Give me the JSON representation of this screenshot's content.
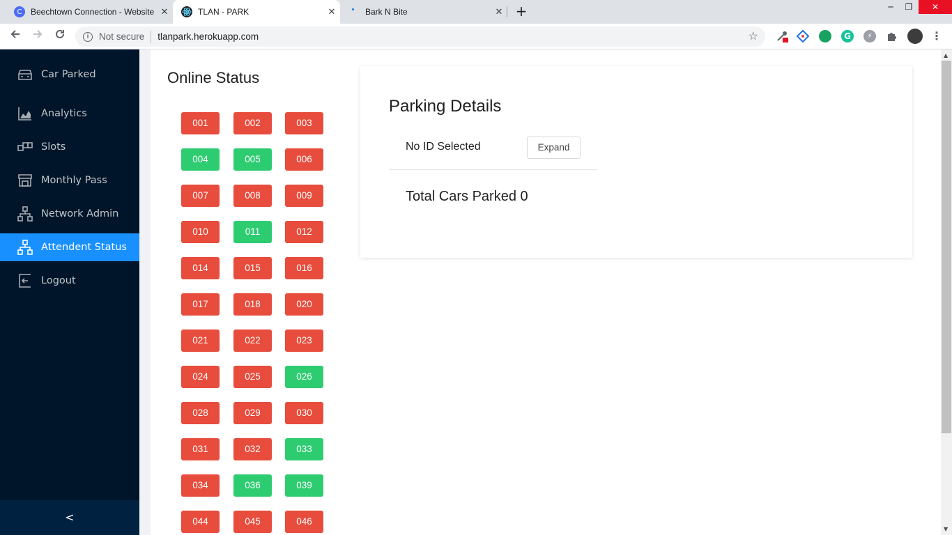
{
  "browser": {
    "tabs": [
      {
        "title": "Beechtown Connection - Website",
        "favicon": "beechtown-c-icon"
      },
      {
        "title": "TLAN - PARK",
        "favicon": "react-icon"
      },
      {
        "title": "Bark N Bite",
        "favicon": "loading-dot-icon"
      }
    ],
    "security_label": "Not secure",
    "url": "tlanpark.herokuapp.com"
  },
  "sidebar": {
    "items": [
      {
        "label": "Car Parked",
        "icon": "car-icon"
      },
      {
        "label": "Analytics",
        "icon": "area-chart-icon"
      },
      {
        "label": "Slots",
        "icon": "slots-icon"
      },
      {
        "label": "Monthly Pass",
        "icon": "shop-icon"
      },
      {
        "label": "Network Admin",
        "icon": "cluster-icon"
      },
      {
        "label": "Attendent Status",
        "icon": "cluster-icon"
      },
      {
        "label": "Logout",
        "icon": "logout-icon"
      }
    ],
    "active_index": 5,
    "collapse_glyph": "<"
  },
  "online_status": {
    "title": "Online Status",
    "slots": [
      {
        "id": "001",
        "online": false
      },
      {
        "id": "002",
        "online": false
      },
      {
        "id": "003",
        "online": false
      },
      {
        "id": "004",
        "online": true
      },
      {
        "id": "005",
        "online": true
      },
      {
        "id": "006",
        "online": false
      },
      {
        "id": "007",
        "online": false
      },
      {
        "id": "008",
        "online": false
      },
      {
        "id": "009",
        "online": false
      },
      {
        "id": "010",
        "online": false
      },
      {
        "id": "011",
        "online": true
      },
      {
        "id": "012",
        "online": false
      },
      {
        "id": "014",
        "online": false
      },
      {
        "id": "015",
        "online": false
      },
      {
        "id": "016",
        "online": false
      },
      {
        "id": "017",
        "online": false
      },
      {
        "id": "018",
        "online": false
      },
      {
        "id": "020",
        "online": false
      },
      {
        "id": "021",
        "online": false
      },
      {
        "id": "022",
        "online": false
      },
      {
        "id": "023",
        "online": false
      },
      {
        "id": "024",
        "online": false
      },
      {
        "id": "025",
        "online": false
      },
      {
        "id": "026",
        "online": true
      },
      {
        "id": "028",
        "online": false
      },
      {
        "id": "029",
        "online": false
      },
      {
        "id": "030",
        "online": false
      },
      {
        "id": "031",
        "online": false
      },
      {
        "id": "032",
        "online": false
      },
      {
        "id": "033",
        "online": true
      },
      {
        "id": "034",
        "online": false
      },
      {
        "id": "036",
        "online": true
      },
      {
        "id": "039",
        "online": true
      },
      {
        "id": "044",
        "online": false
      },
      {
        "id": "045",
        "online": false
      },
      {
        "id": "046",
        "online": false
      }
    ]
  },
  "parking_details": {
    "title": "Parking Details",
    "selected_label": "No ID Selected",
    "expand_label": "Expand",
    "total_label": "Total Cars Parked",
    "total_value": "0"
  },
  "colors": {
    "sidebar_bg": "#001529",
    "active_item": "#1890ff",
    "offline": "#e74c3c",
    "online": "#2ecc71"
  }
}
